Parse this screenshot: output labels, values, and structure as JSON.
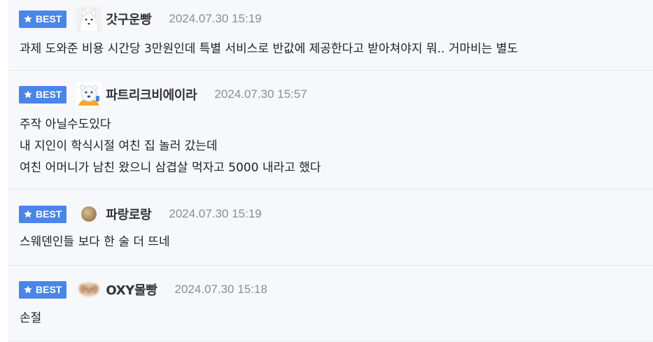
{
  "badge_label": "BEST",
  "comments": [
    {
      "nickname": "갓구운빵",
      "avatar": "white-fox-avatar",
      "date": "2024.07.30 15:19",
      "lines": [
        "과제 도와준 비용 시간당 3만원인데 특별 서비스로 반값에 제공한다고 받아쳐야지 뭐.. 거마비는 별도"
      ]
    },
    {
      "nickname": "파트리크비에이라",
      "avatar": "polar-bear-avatar",
      "date": "2024.07.30 15:57",
      "lines": [
        "주작 아닐수도있다",
        "내 지인이 학식시절 여친 집 놀러 갔는데",
        "여친 어머니가 남친 왔으니 삼겹살 먹자고 5000 내라고 했다"
      ]
    },
    {
      "nickname": "파랑로랑",
      "avatar": "brown-ball-avatar",
      "date": "2024.07.30 15:19",
      "lines": [
        "스웨덴인들 보다 한 술 더 뜨네"
      ]
    },
    {
      "nickname": "OXY몰빵",
      "avatar": "blurred-dog-avatar",
      "date": "2024.07.30 15:18",
      "lines": [
        "손절"
      ]
    }
  ],
  "colors": {
    "badge_bg": "#4a86e8",
    "comment_bg": "#f7f8fc",
    "date_text": "#8d8d8d"
  }
}
